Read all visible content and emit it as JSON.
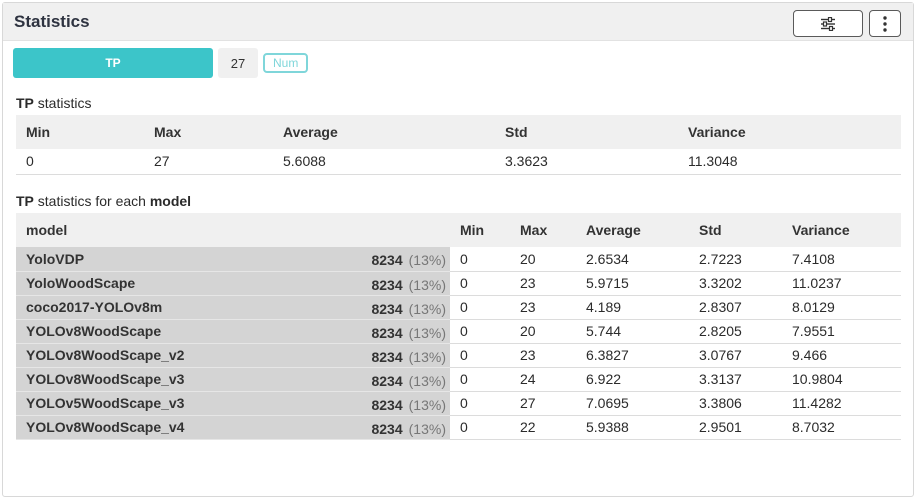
{
  "panel": {
    "title": "Statistics",
    "filter_icon": "sliders-icon",
    "more_icon": "more-vertical-icon"
  },
  "metric": {
    "name": "TP",
    "count": "27",
    "type_badge": "Num"
  },
  "summary": {
    "title_metric": "TP",
    "title_suffix": "statistics",
    "headers": [
      "Min",
      "Max",
      "Average",
      "Std",
      "Variance"
    ],
    "row": [
      "0",
      "27",
      "5.6088",
      "3.3623",
      "11.3048"
    ]
  },
  "per_model": {
    "title_metric": "TP",
    "title_middle": "statistics for each",
    "title_group": "model",
    "headers": [
      "model",
      "Min",
      "Max",
      "Average",
      "Std",
      "Variance"
    ],
    "rows": [
      {
        "model": "YoloVDP",
        "count": "8234",
        "pct": "(13%)",
        "min": "0",
        "max": "20",
        "avg": "2.6534",
        "std": "2.7223",
        "var": "7.4108"
      },
      {
        "model": "YoloWoodScape",
        "count": "8234",
        "pct": "(13%)",
        "min": "0",
        "max": "23",
        "avg": "5.9715",
        "std": "3.3202",
        "var": "11.0237"
      },
      {
        "model": "coco2017-YOLOv8m",
        "count": "8234",
        "pct": "(13%)",
        "min": "0",
        "max": "23",
        "avg": "4.189",
        "std": "2.8307",
        "var": "8.0129"
      },
      {
        "model": "YOLOv8WoodScape",
        "count": "8234",
        "pct": "(13%)",
        "min": "0",
        "max": "20",
        "avg": "5.744",
        "std": "2.8205",
        "var": "7.9551"
      },
      {
        "model": "YOLOv8WoodScape_v2",
        "count": "8234",
        "pct": "(13%)",
        "min": "0",
        "max": "23",
        "avg": "6.3827",
        "std": "3.0767",
        "var": "9.466"
      },
      {
        "model": "YOLOv8WoodScape_v3",
        "count": "8234",
        "pct": "(13%)",
        "min": "0",
        "max": "24",
        "avg": "6.922",
        "std": "3.3137",
        "var": "10.9804"
      },
      {
        "model": "YOLOv5WoodScape_v3",
        "count": "8234",
        "pct": "(13%)",
        "min": "0",
        "max": "27",
        "avg": "7.0695",
        "std": "3.3806",
        "var": "11.4282"
      },
      {
        "model": "YOLOv8WoodScape_v4",
        "count": "8234",
        "pct": "(13%)",
        "min": "0",
        "max": "22",
        "avg": "5.9388",
        "std": "2.9501",
        "var": "8.7032"
      }
    ]
  }
}
